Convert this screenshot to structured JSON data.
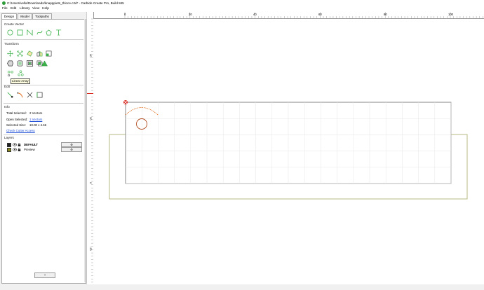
{
  "window": {
    "title": "C:/Users/vella/Downloads/knapppiets_thince.c2d* - Carbide Create Pro, Build 845"
  },
  "menu": [
    "File",
    "Edit",
    "Library",
    "View",
    "Help"
  ],
  "tabs": [
    "Design",
    "Model",
    "Toolpaths"
  ],
  "active_tab": "Design",
  "sections": {
    "create_vector": "Create Vector",
    "transform": "Transform",
    "edit": "Edit",
    "info": "Info",
    "layers": "Layers"
  },
  "create_vector_icons": [
    "circle-icon",
    "rectangle-icon",
    "polyline-icon",
    "curve-icon",
    "polygon-icon",
    "text-icon"
  ],
  "transform_icons_row1": [
    "move-icon",
    "scale-icon",
    "rotate-icon",
    "mirror-icon",
    "align-icon"
  ],
  "transform_icons_row2": [
    "offset-icon",
    "boolean-union-icon",
    "boolean-subtract-icon",
    "boolean-intersect-icon",
    "warning-icon"
  ],
  "transform_icons_row3": [
    "circular-array-icon",
    "linear-array-icon"
  ],
  "tooltip": "Linear Array",
  "edit_icons": [
    "node-edit-icon",
    "trim-icon",
    "cut-icon",
    "join-icon"
  ],
  "info": {
    "total_selected_label": "Total Selected:",
    "total_selected_value": "2 Vectors",
    "open_selected_label": "Open Selected:",
    "open_selected_value": "1 Vectors",
    "selected_size_label": "Selected Size:",
    "selected_size_value": "10.00 x 4.66",
    "check_cutter_link": "Check Cutter Access"
  },
  "layers": [
    {
      "name": "DEFAULT",
      "color": "#222222",
      "bold": true,
      "button": "⚙"
    },
    {
      "name": "Preview",
      "color": "#8a8a1a",
      "bold": false,
      "button": "⚙"
    }
  ],
  "bottom_button": "+",
  "ruler": {
    "h_labels": [
      "0",
      "20",
      "40",
      "60",
      "80",
      "100"
    ],
    "v_labels": [
      "40",
      "20",
      "0",
      "-20"
    ]
  },
  "colors": {
    "accent_green": "#3cb24a",
    "selection_orange": "#e06a1a",
    "origin_red": "#d8281e",
    "stock_outline": "#a8a864"
  }
}
